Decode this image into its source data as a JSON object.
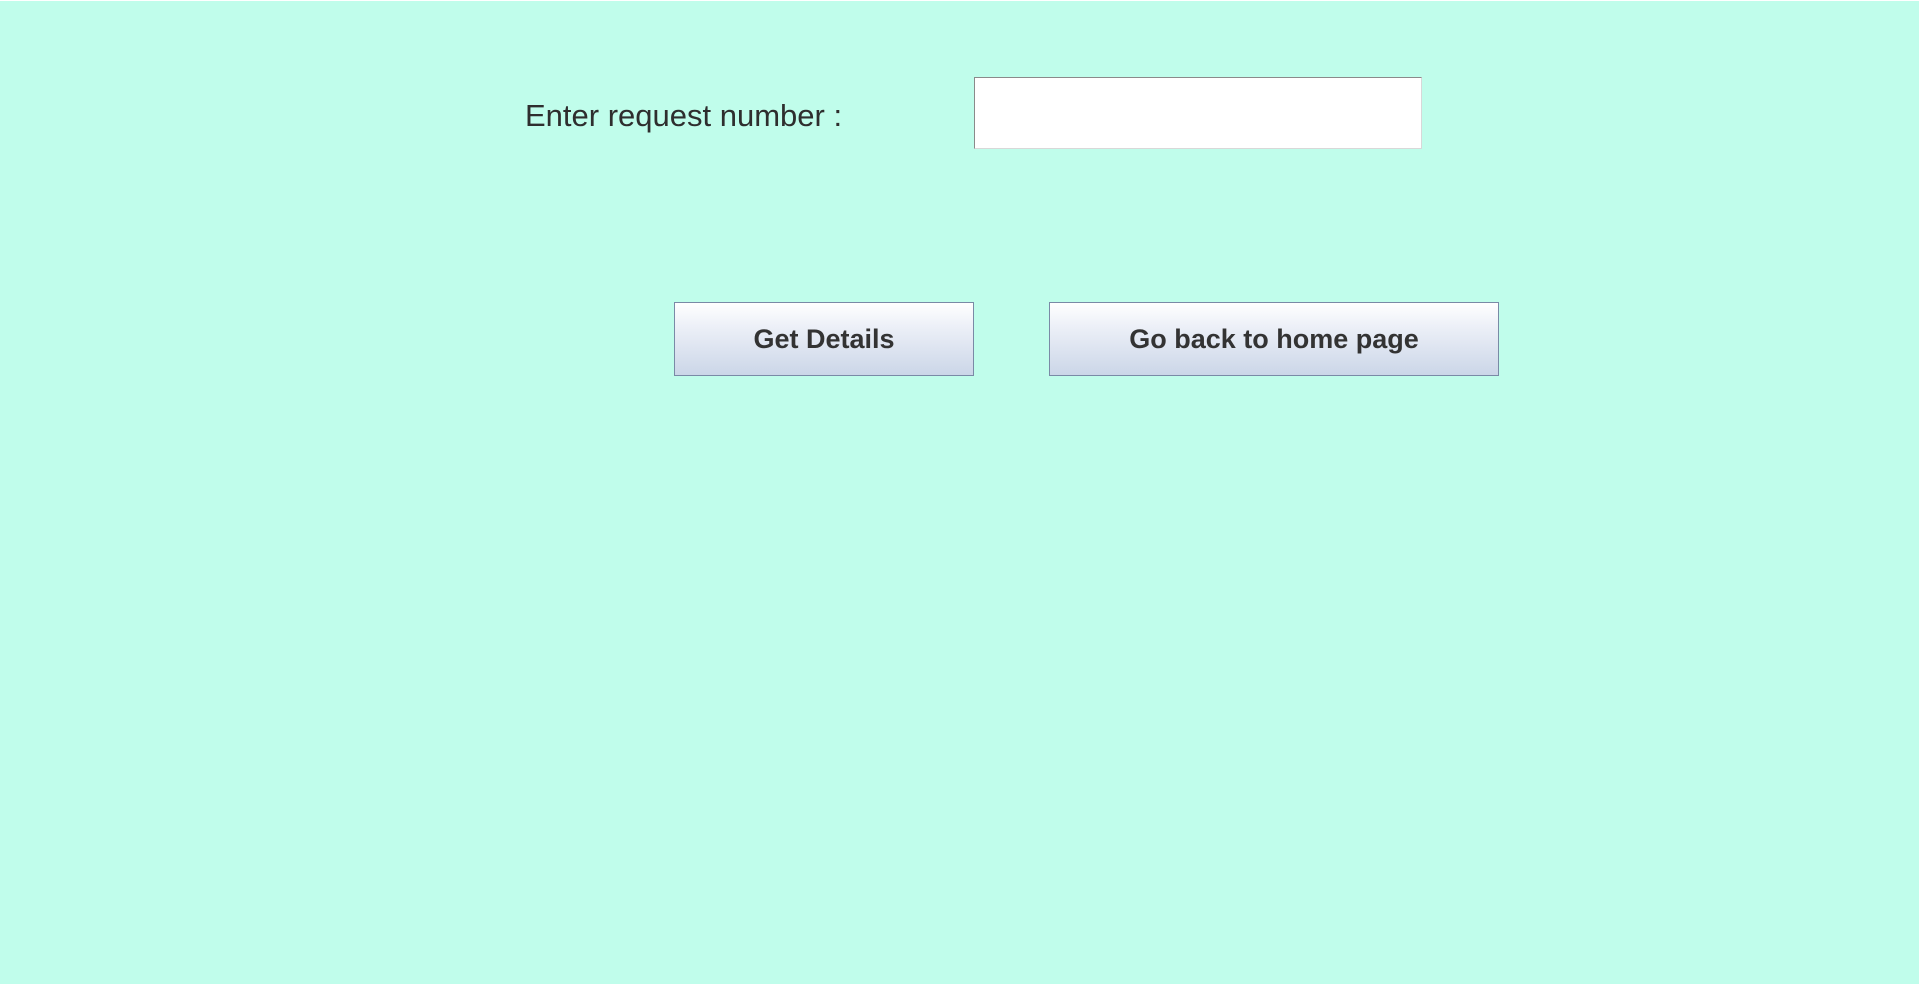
{
  "form": {
    "request_label": "Enter request number :",
    "request_value": "",
    "request_placeholder": ""
  },
  "actions": {
    "get_details_label": "Get Details",
    "home_label": "Go back to home page"
  },
  "colors": {
    "background": "#c0fdeb",
    "text": "#2e2e2e",
    "button_top": "#ffffff",
    "button_bottom": "#cbd6e8",
    "button_border": "#7a8aa6"
  }
}
